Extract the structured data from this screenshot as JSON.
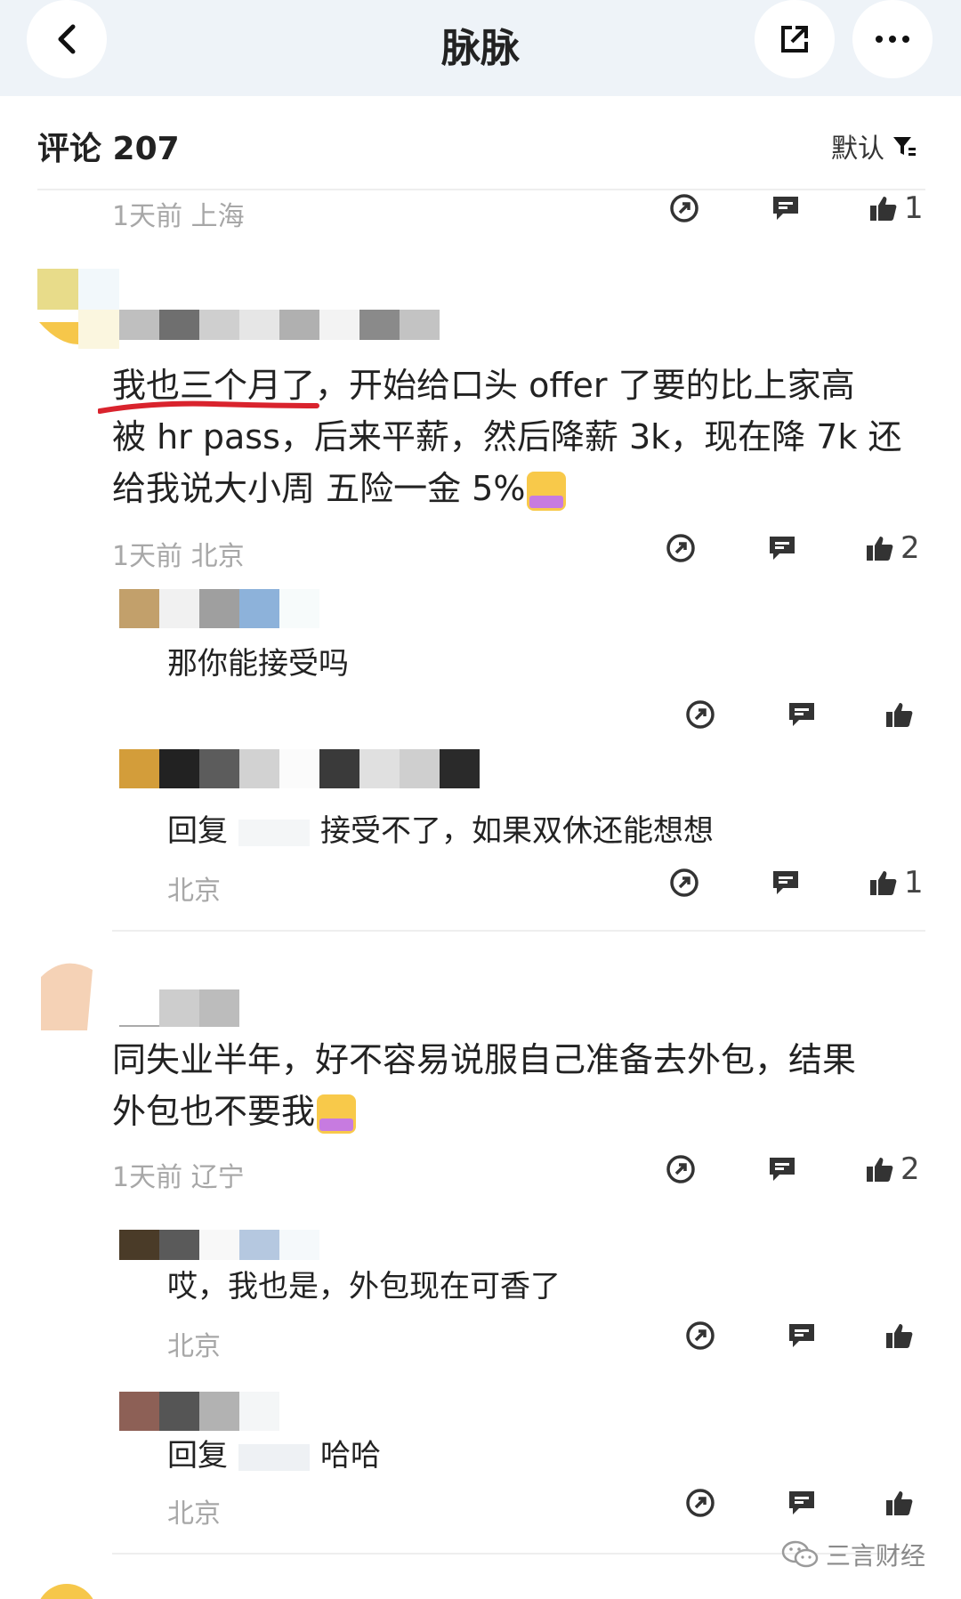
{
  "header": {
    "title": "脉脉"
  },
  "comments_header": {
    "label": "评论 207",
    "sort_label": "默认"
  },
  "items": [
    {
      "meta": "1天前  上海",
      "likes": "1"
    },
    {
      "text_lines": [
        "我也三个月了，开始给口头 offer 了要的比上家高",
        "被 hr pass，后来平薪，然后降薪 3k，现在降 7k 还",
        "给我说大小周 五险一金 5%"
      ],
      "meta": "1天前  北京",
      "likes": "2"
    },
    {
      "text": "那你能接受吗",
      "meta": "北京",
      "likes": ""
    },
    {
      "text_prefix": "回复",
      "text": "接受不了，如果双休还能想想",
      "meta": "北京",
      "likes": "1"
    },
    {
      "text_lines": [
        "同失业半年，好不容易说服自己准备去外包，结果",
        "外包也不要我"
      ],
      "meta": "1天前  辽宁",
      "likes": "2"
    },
    {
      "text": "哎，我也是，外包现在可香了",
      "meta": "北京",
      "likes": ""
    },
    {
      "text_prefix": "回复",
      "text": "哈哈",
      "meta": "北京",
      "likes": ""
    }
  ],
  "watermark": {
    "label": "三言财经"
  },
  "colors": {
    "topbar": "#eef3f8",
    "meta": "#a7a7a7",
    "underline": "#d9232d"
  }
}
